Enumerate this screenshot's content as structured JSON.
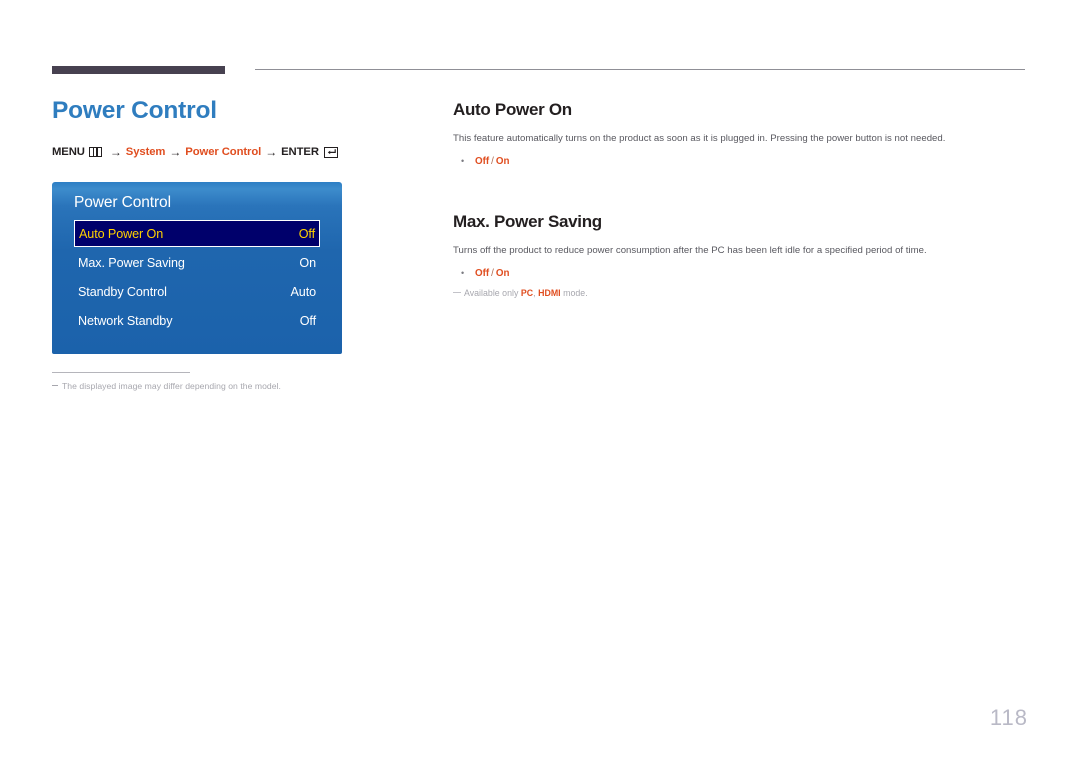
{
  "header": {
    "bar_color": "#474150",
    "rule_color": "#8f8f96"
  },
  "left": {
    "page_title": "Power Control",
    "menu_path": {
      "menu_label": "MENU",
      "menu_icon": "menu-grid-icon",
      "arrow": "→",
      "step1": "System",
      "step2": "Power Control",
      "enter_label": "ENTER",
      "enter_icon": "enter-key-icon"
    },
    "osd": {
      "title": "Power Control",
      "rows": [
        {
          "label": "Auto Power On",
          "value": "Off",
          "selected": true
        },
        {
          "label": "Max. Power Saving",
          "value": "On",
          "selected": false
        },
        {
          "label": "Standby Control",
          "value": "Auto",
          "selected": false
        },
        {
          "label": "Network Standby",
          "value": "Off",
          "selected": false
        }
      ],
      "bg_color": "#1f66ae",
      "selected_bg": "#00006b",
      "selected_text": "#ffd200"
    },
    "footnote": "The displayed image may differ depending on the model."
  },
  "right": {
    "sections": [
      {
        "title": "Auto Power On",
        "body": "This feature automatically turns on the product as soon as it is plugged in. Pressing the power button is not needed.",
        "option_first": "Off",
        "option_sep": "/",
        "option_second": "On"
      },
      {
        "title": "Max. Power Saving",
        "body": "Turns off the product to reduce power consumption after the PC has been left idle for a specified period of time.",
        "option_first": "Off",
        "option_sep": "/",
        "option_second": "On",
        "note_prefix": "Available only ",
        "note_a": "PC",
        "note_mid": ", ",
        "note_b": "HDMI",
        "note_suffix": " mode."
      }
    ]
  },
  "page_number": "118"
}
